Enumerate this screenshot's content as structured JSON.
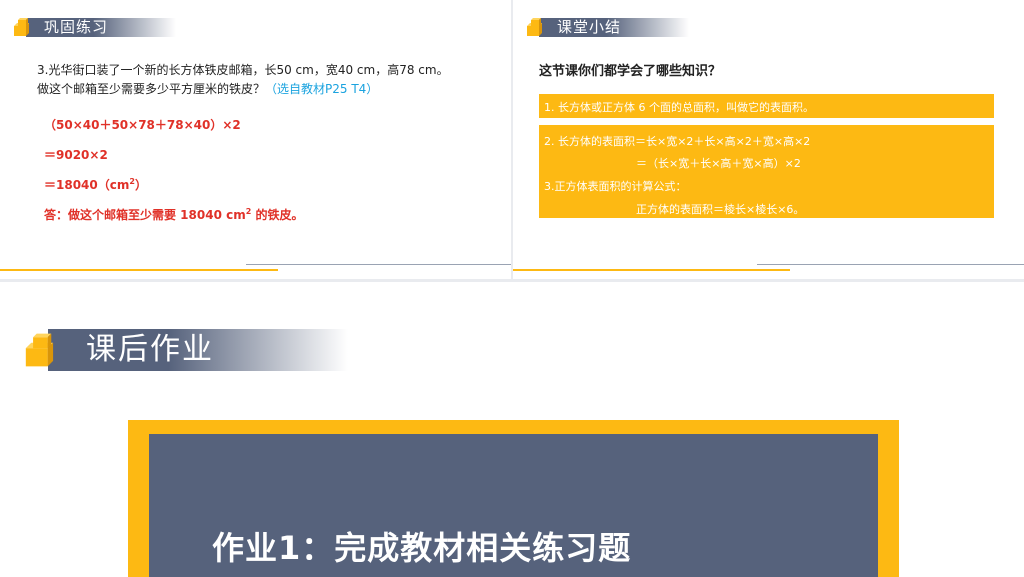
{
  "slide1": {
    "header_title": "巩固练习",
    "problem_line1": "3.光华街口装了一个新的长方体铁皮邮箱，长50 cm，宽40 cm，高78 cm。",
    "problem_line2": "做这个邮箱至少需要多少平方厘米的铁皮？",
    "problem_source": "（选自教材P25  T4）",
    "step1": "（50×40＋50×78＋78×40）×2",
    "step2": "＝9020×2",
    "step3_value": "＝18040（cm",
    "step3_sup": "2",
    "step3_end": "）",
    "answer_main": "答：做这个邮箱至少需要 18040 cm",
    "answer_sup": "2",
    "answer_end": " 的铁皮。"
  },
  "slide2": {
    "header_title": "课堂小结",
    "question": "这节课你们都学会了哪些知识？",
    "point1": "1. 长方体或正方体 6 个面的总面积，叫做它的表面积。",
    "point2_a": "2.    长方体的表面积＝长×宽×2＋长×高×2＋宽×高×2",
    "point2_b": "＝（长×宽＋长×高＋宽×高）×2",
    "point3_a": "3.正方体表面积的计算公式：",
    "point3_b": "正方体的表面积＝棱长×棱长×6。"
  },
  "slide3": {
    "header_title": "课后作业",
    "homework": "作业1：完成教材相关练习题"
  },
  "colors": {
    "accent_gold": "#fdb913",
    "header_slate": "#56627c",
    "answer_red": "#e03128",
    "source_blue": "#1ba3df"
  },
  "icons": [
    "stacked-blocks-icon"
  ]
}
